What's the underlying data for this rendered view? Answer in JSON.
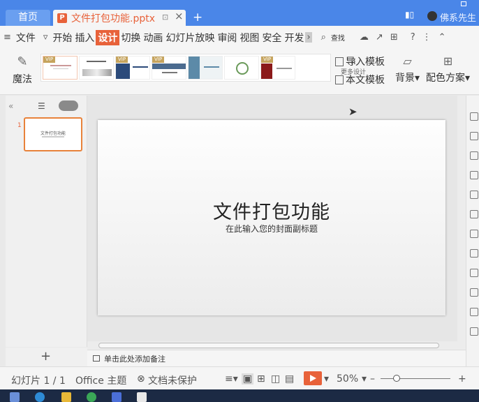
{
  "tabs": {
    "home": "首页",
    "document": "文件打包功能.pptx",
    "user": "佛系先生"
  },
  "menu": {
    "file": "文件",
    "items": [
      "开始",
      "插入",
      "设计",
      "切换",
      "动画",
      "幻灯片放映",
      "审阅",
      "视图",
      "安全",
      "开发"
    ],
    "active": "设计",
    "search": "查找"
  },
  "ribbon": {
    "magic": "魔法",
    "vip_badge": "VIP",
    "more_design": "更多设计",
    "import_template": "导入模板",
    "text_template": "本文模板",
    "background": "背景",
    "color_scheme": "配色方案"
  },
  "slides": {
    "current_number": "1",
    "thumb_title": "文件打包功能"
  },
  "slide": {
    "title": "文件打包功能",
    "subtitle": "在此输入您的封面副标题"
  },
  "notes": {
    "placeholder": "单击此处添加备注"
  },
  "status": {
    "slide_count": "幻灯片 1 / 1",
    "theme": "Office 主题",
    "protection": "文档未保护",
    "zoom": "50%"
  },
  "colors": {
    "accent": "#e8623a",
    "titlebar": "#4a86e8"
  }
}
